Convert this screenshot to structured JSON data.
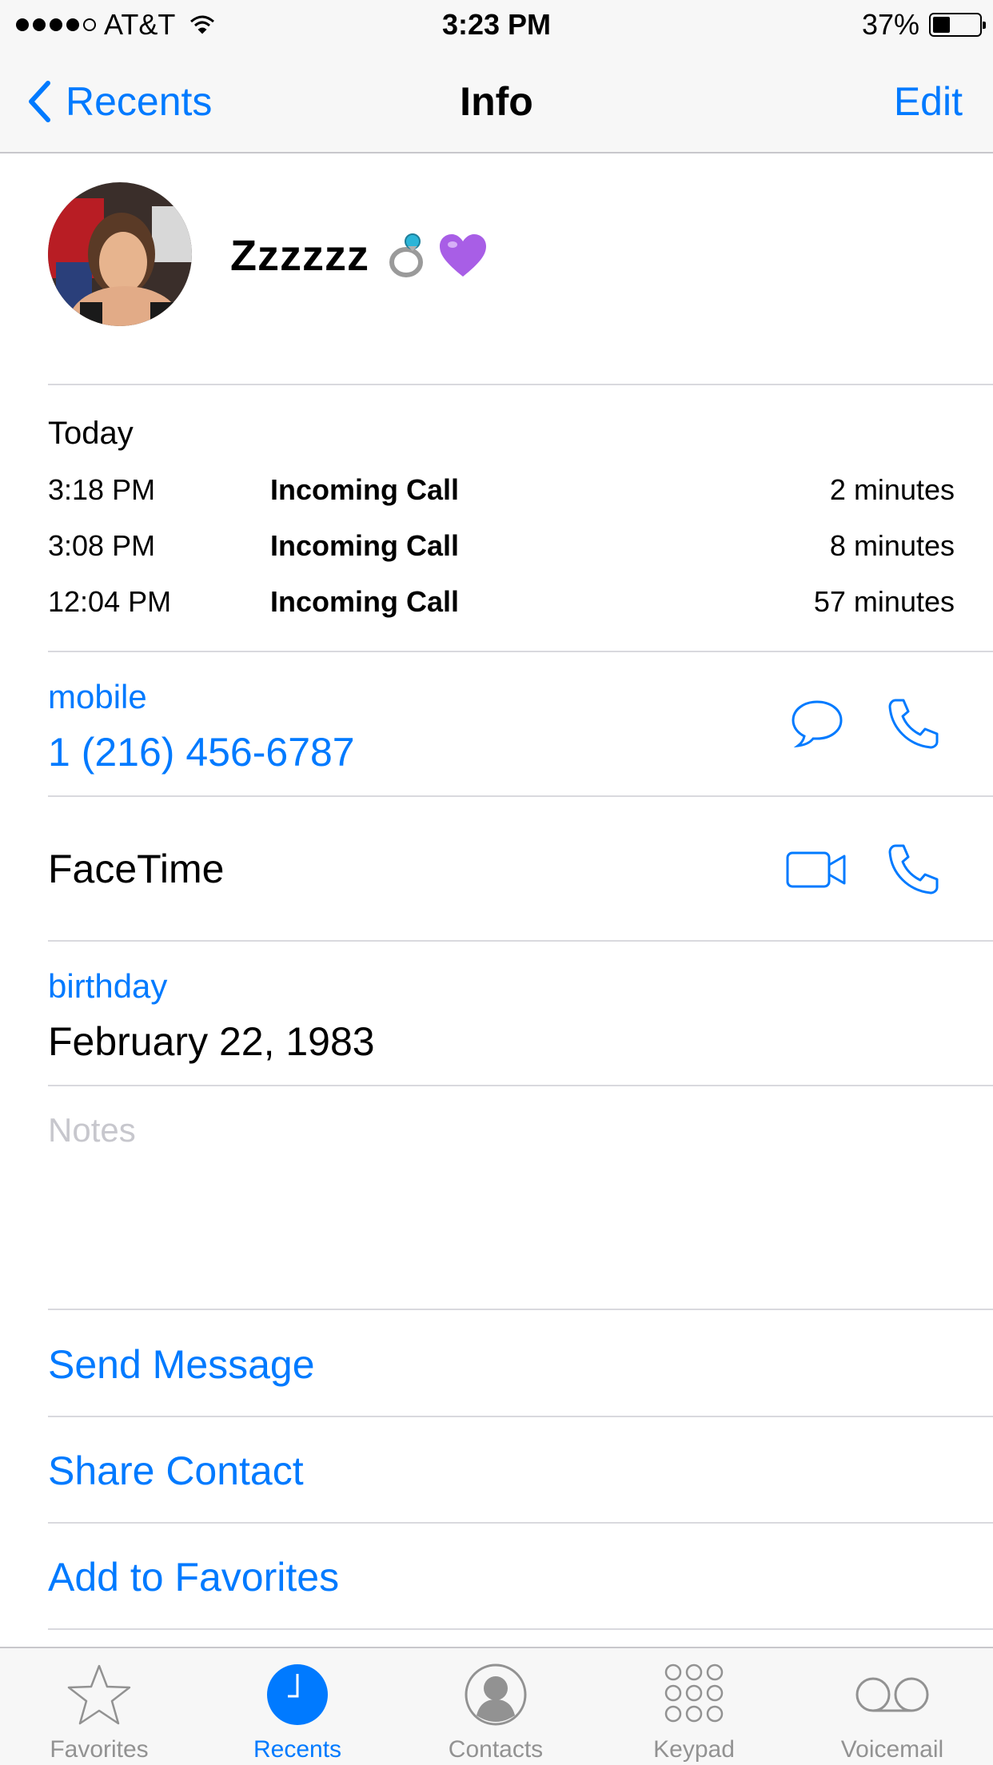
{
  "status_bar": {
    "carrier": "AT&T",
    "time": "3:23 PM",
    "battery_percent": "37%",
    "battery_level": 0.37,
    "signal_bars": 4
  },
  "nav": {
    "back_label": "Recents",
    "title": "Info",
    "edit_label": "Edit"
  },
  "contact": {
    "name": "Zzzzzz",
    "emoji": [
      "ring",
      "purple-heart"
    ]
  },
  "calls": {
    "day_label": "Today",
    "items": [
      {
        "time": "3:18 PM",
        "type": "Incoming Call",
        "duration": "2 minutes"
      },
      {
        "time": "3:08 PM",
        "type": "Incoming Call",
        "duration": "8 minutes"
      },
      {
        "time": "12:04 PM",
        "type": "Incoming Call",
        "duration": "57 minutes"
      }
    ]
  },
  "phone": {
    "label": "mobile",
    "number": "1 (216) 456-6787"
  },
  "facetime": {
    "label": "FaceTime"
  },
  "birthday": {
    "label": "birthday",
    "value": "February 22, 1983"
  },
  "notes": {
    "placeholder": "Notes"
  },
  "actions": {
    "send_message": "Send Message",
    "share_contact": "Share Contact",
    "add_favorites": "Add to Favorites"
  },
  "tabbar": {
    "items": [
      {
        "label": "Favorites",
        "icon": "star-icon"
      },
      {
        "label": "Recents",
        "icon": "clock-icon",
        "active": true
      },
      {
        "label": "Contacts",
        "icon": "person-icon"
      },
      {
        "label": "Keypad",
        "icon": "keypad-icon"
      },
      {
        "label": "Voicemail",
        "icon": "voicemail-icon"
      }
    ]
  },
  "colors": {
    "accent": "#007aff",
    "separator": "#d9d9de",
    "bar_background": "#f7f7f7",
    "tab_inactive": "#929292"
  }
}
